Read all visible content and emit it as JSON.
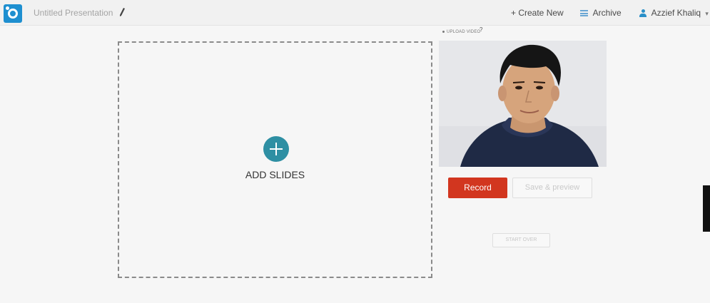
{
  "header": {
    "doc_title": "Untitled Presentation",
    "create_new": "+ Create New",
    "archive": "Archive",
    "user_name": "Azzief Khaliq",
    "user_caret": "▾"
  },
  "slides": {
    "add_label": "ADD SLIDES"
  },
  "video": {
    "upload_label": "UPLOAD VIDEO",
    "help_mark": "?",
    "record_label": "Record",
    "save_preview_label": "Save & preview",
    "start_over_label": "START OVER"
  },
  "colors": {
    "brand": "#1e8fd0",
    "record": "#d2361f",
    "add_circle": "#2e8fa3"
  }
}
